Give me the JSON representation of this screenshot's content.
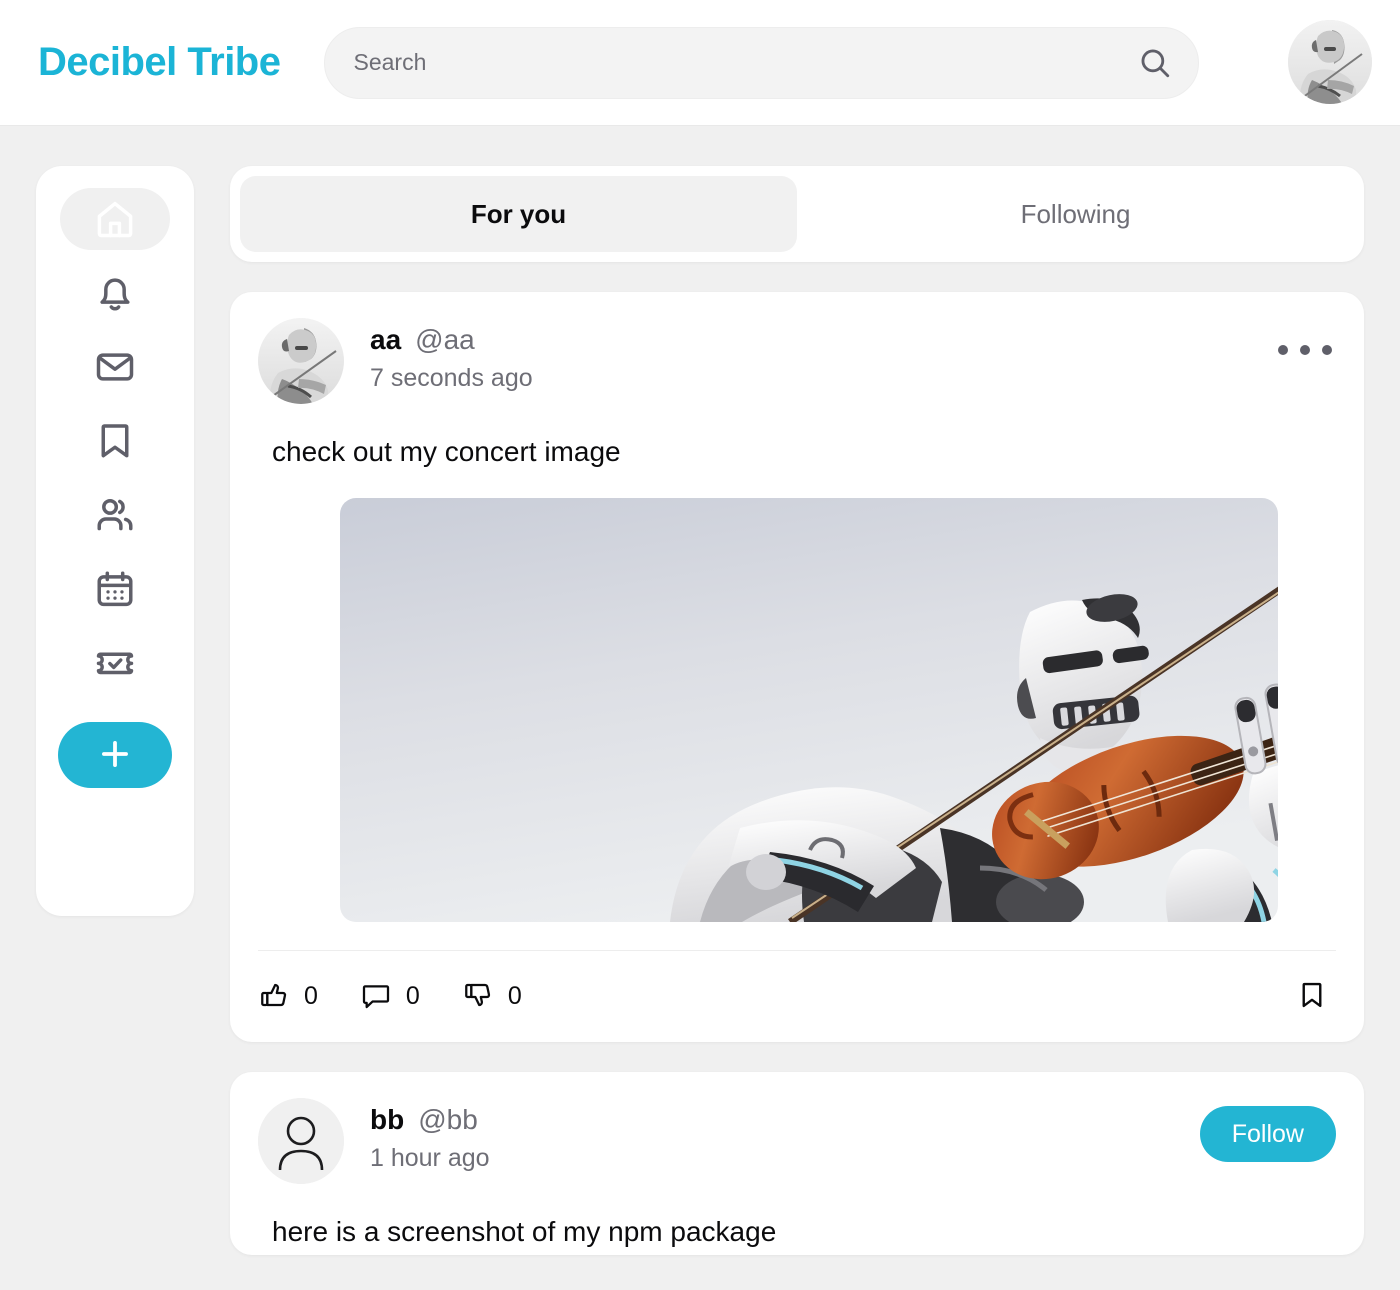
{
  "header": {
    "brand": "Decibel Tribe",
    "search_placeholder": "Search",
    "search_value": "",
    "search_icon": "search-icon",
    "avatar_alt": "robot-violinist-avatar"
  },
  "sidebar": {
    "items": [
      {
        "name": "home",
        "icon": "home-icon",
        "active": true
      },
      {
        "name": "notifications",
        "icon": "bell-icon",
        "active": false
      },
      {
        "name": "messages",
        "icon": "envelope-icon",
        "active": false
      },
      {
        "name": "bookmarks",
        "icon": "bookmark-icon",
        "active": false
      },
      {
        "name": "communities",
        "icon": "users-icon",
        "active": false
      },
      {
        "name": "events",
        "icon": "calendar-icon",
        "active": false
      },
      {
        "name": "tickets",
        "icon": "ticket-check-icon",
        "active": false
      }
    ],
    "compose": {
      "icon": "plus-icon",
      "label": ""
    }
  },
  "tabs": [
    {
      "label": "For you",
      "active": true
    },
    {
      "label": "Following",
      "active": false
    }
  ],
  "posts": [
    {
      "display_name": "aa",
      "handle": "@aa",
      "timestamp": "7 seconds ago",
      "text": "check out my concert image",
      "avatar_alt": "robot-violinist-avatar",
      "has_image": true,
      "image_alt": "white humanoid robot playing a violin against pale sky",
      "menu_icon": "ellipsis-icon",
      "actions": {
        "like": {
          "icon": "thumbs-up-icon",
          "count": "0"
        },
        "comment": {
          "icon": "comment-icon",
          "count": "0"
        },
        "dislike": {
          "icon": "thumbs-down-icon",
          "count": "0"
        },
        "save": {
          "icon": "bookmark-icon"
        }
      }
    },
    {
      "display_name": "bb",
      "handle": "@bb",
      "timestamp": "1 hour ago",
      "text": "here is a screenshot of my npm package",
      "avatar_alt": "default-person-avatar",
      "has_image": false,
      "follow_label": "Follow"
    }
  ],
  "colors": {
    "brand": "#1bb4d6",
    "accent": "#23b5d3",
    "page_bg": "#f0f0f0",
    "card_bg": "#ffffff",
    "text": "#0b0b0d",
    "muted": "#6e6e76"
  }
}
